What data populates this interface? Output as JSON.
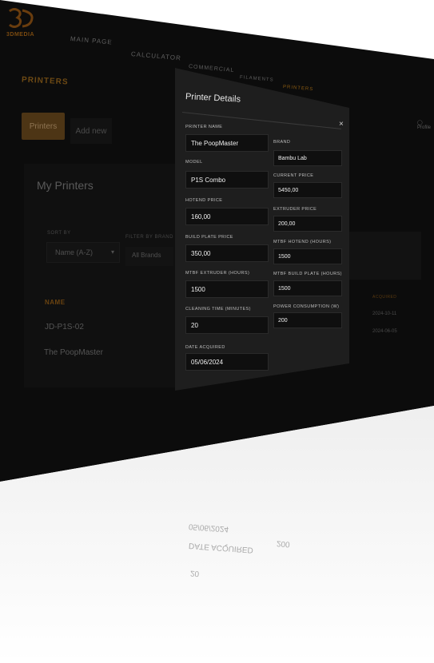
{
  "app": {
    "logo_text": "3DMEDIA",
    "nav": {
      "main": "MAIN PAGE",
      "calculator": "CALCULATOR",
      "commercial": "COMMERCIAL",
      "filaments": "FILAMENTS",
      "printers": "PRINTERS"
    },
    "profile": "Profile"
  },
  "page": {
    "title": "PRINTERS",
    "tab_printers": "Printers",
    "tab_add": "Add new",
    "list_title": "My Printers",
    "sort_label": "SORT BY",
    "sort_value": "Name (A-Z)",
    "filter_label": "FILTER BY BRAND",
    "filter_value": "All Brands",
    "col_name": "NAME",
    "col_acquired": "ACQUIRED",
    "rows": [
      {
        "name": "JD-P1S-02",
        "acquired": "2024-10-11"
      },
      {
        "name": "The PoopMaster",
        "acquired": "2024-06-05"
      }
    ]
  },
  "modal": {
    "title": "Printer Details",
    "close": "×",
    "fields": {
      "printer_name": {
        "label": "PRINTER NAME",
        "value": "The PoopMaster"
      },
      "brand": {
        "label": "BRAND",
        "value": "Bambu Lab"
      },
      "model": {
        "label": "MODEL",
        "value": "P1S Combo"
      },
      "current_price": {
        "label": "CURRENT PRICE",
        "value": "5450,00"
      },
      "hotend_price": {
        "label": "HOTEND PRICE",
        "value": "160,00"
      },
      "extruder_price": {
        "label": "EXTRUDER PRICE",
        "value": "200,00"
      },
      "build_plate_price": {
        "label": "BUILD PLATE PRICE",
        "value": "350,00"
      },
      "mtbf_hotend": {
        "label": "MTBF HOTEND (HOURS)",
        "value": "1500"
      },
      "mtbf_extruder": {
        "label": "MTBF EXTRUDER (HOURS)",
        "value": "1500"
      },
      "mtbf_build_plate": {
        "label": "MTBF BUILD PLATE (HOURS)",
        "value": "1500"
      },
      "cleaning_time": {
        "label": "CLEANING TIME (MINUTES)",
        "value": "20"
      },
      "power_consumption": {
        "label": "POWER CONSUMPTION (W)",
        "value": "200"
      },
      "date_acquired": {
        "label": "DATE ACQUIRED",
        "value": "05/06/2024"
      }
    }
  },
  "colors": {
    "accent": "#8a5a12",
    "background": "#0c0c0c",
    "modal": "#1e1e1e"
  }
}
